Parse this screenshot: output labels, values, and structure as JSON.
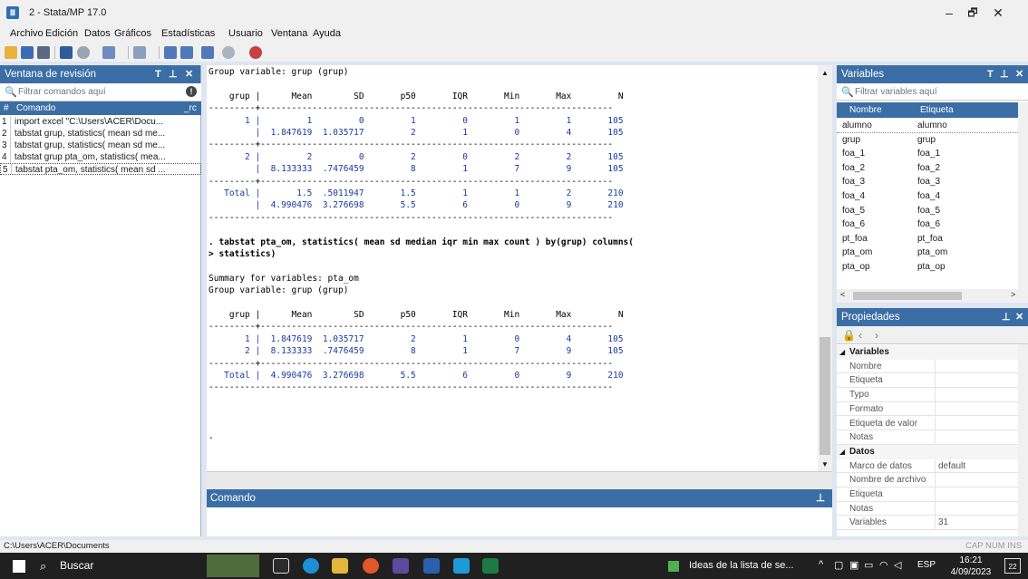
{
  "window": {
    "title": "2 - Stata/MP 17.0",
    "app_icon": "Ⅲ"
  },
  "menu": [
    "Archivo",
    "Edición",
    "Datos",
    "Gráficos",
    "Estadísticas",
    "Usuario",
    "Ventana",
    "Ayuda"
  ],
  "review": {
    "title": "Ventana de revisión",
    "filter_placeholder": "Filtrar comandos aquí",
    "col_num": "#",
    "col_cmd": "Comando",
    "col_rc": "_rc",
    "items": [
      {
        "n": "1",
        "cmd": "import excel \"C:\\Users\\ACER\\Docu..."
      },
      {
        "n": "2",
        "cmd": "tabstat grup, statistics( mean sd me..."
      },
      {
        "n": "3",
        "cmd": "tabstat grup, statistics( mean sd me..."
      },
      {
        "n": "4",
        "cmd": "tabstat grup pta_om, statistics( mea..."
      },
      {
        "n": "5",
        "cmd": "tabstat pta_om, statistics( mean sd ..."
      }
    ]
  },
  "results": {
    "lines": [
      "Group variable: grup (grup)",
      "",
      "    grup |      Mean        SD       p50       IQR       Min       Max         N",
      "---------+--------------------------------------------------------------------",
      "       1 |         1         0         1         0         1         1       105",
      "         |  1.847619  1.035717         2         1         0         4       105",
      "---------+--------------------------------------------------------------------",
      "       2 |         2         0         2         0         2         2       105",
      "         |  8.133333  .7476459         8         1         7         9       105",
      "---------+--------------------------------------------------------------------",
      "   Total |       1.5  .5011947       1.5         1         1         2       210",
      "         |  4.990476  3.276698       5.5         6         0         9       210",
      "------------------------------------------------------------------------------",
      "",
      ". tabstat pta_om, statistics( mean sd median iqr min max count ) by(grup) columns(",
      "> statistics)",
      "",
      "Summary for variables: pta_om",
      "Group variable: grup (grup)",
      "",
      "    grup |      Mean        SD       p50       IQR       Min       Max         N",
      "---------+--------------------------------------------------------------------",
      "       1 |  1.847619  1.035717         2         1         0         4       105",
      "       2 |  8.133333  .7476459         8         1         7         9       105",
      "---------+--------------------------------------------------------------------",
      "   Total |  4.990476  3.276698       5.5         6         0         9       210",
      "------------------------------------------------------------------------------",
      "",
      "",
      "",
      ".",
      ""
    ]
  },
  "command": {
    "title": "Comando",
    "pin": "⊥"
  },
  "variables": {
    "title": "Variables",
    "filter_placeholder": "Filtrar variables aquí",
    "col_name": "Nombre",
    "col_label": "Etiqueta",
    "rows": [
      {
        "name": "alumno",
        "label": "alumno"
      },
      {
        "name": "grup",
        "label": "grup"
      },
      {
        "name": "foa_1",
        "label": "foa_1"
      },
      {
        "name": "foa_2",
        "label": "foa_2"
      },
      {
        "name": "foa_3",
        "label": "foa_3"
      },
      {
        "name": "foa_4",
        "label": "foa_4"
      },
      {
        "name": "foa_5",
        "label": "foa_5"
      },
      {
        "name": "foa_6",
        "label": "foa_6"
      },
      {
        "name": "pt_foa",
        "label": "pt_foa"
      },
      {
        "name": "pta_om",
        "label": "pta_om"
      },
      {
        "name": "pta_op",
        "label": "pta_op"
      }
    ]
  },
  "properties": {
    "title": "Propiedades",
    "sections": [
      {
        "name": "Variables",
        "rows": [
          {
            "k": "Nombre",
            "v": ""
          },
          {
            "k": "Etiqueta",
            "v": ""
          },
          {
            "k": "Typo",
            "v": ""
          },
          {
            "k": "Formato",
            "v": ""
          },
          {
            "k": "Etiqueta de valor",
            "v": ""
          },
          {
            "k": "Notas",
            "v": ""
          }
        ]
      },
      {
        "name": "Datos",
        "rows": [
          {
            "k": "Marco de datos",
            "v": "default"
          },
          {
            "k": "Nombre de archivo",
            "v": ""
          },
          {
            "k": "Etiqueta",
            "v": ""
          },
          {
            "k": "Notas",
            "v": ""
          },
          {
            "k": "Variables",
            "v": "31"
          }
        ]
      }
    ]
  },
  "status": {
    "path": "C:\\Users\\ACER\\Documents",
    "indicators": "CAP  NUM  INS"
  },
  "taskbar": {
    "search": "Buscar",
    "news": "Ideas de la lista de se...",
    "lang": "ESP",
    "time": "16:21",
    "date": "4/09/2023",
    "notif_count": "22"
  }
}
